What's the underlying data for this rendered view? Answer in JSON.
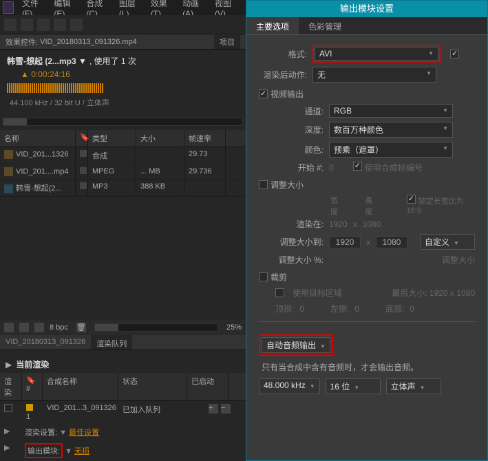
{
  "menu": {
    "file": "文件(F)",
    "edit": "编辑(E)",
    "comp": "合成(C)",
    "layer": "图层(L)",
    "effect": "效果(T)",
    "anim": "动画(A)",
    "view": "视图(V)"
  },
  "fx_header": {
    "label": "效果控件:",
    "file": "VID_20180313_091326.mp4",
    "proj": "项目"
  },
  "info": {
    "title_a": "韩雪-想起 (2...mp3 ▼",
    "title_b": ", 使用了 1 次",
    "time": "▲ 0:00:24:16",
    "audio_meta": "44.100 kHz / 32 bit U / 立体声"
  },
  "cols": {
    "name": "名称",
    "type": "类型",
    "size": "大小",
    "fps": "帧速率"
  },
  "files": [
    {
      "name": "VID_201...1326",
      "type": "合成",
      "size": "",
      "fps": "29.73"
    },
    {
      "name": "VID_201....mp4",
      "type": "MPEG",
      "size": "... MB",
      "fps": "29.736"
    },
    {
      "name": "韩雪-想起(2...",
      "type": "MP3",
      "size": "388 KB",
      "fps": ""
    }
  ],
  "status": {
    "bpc": "8 bpc",
    "pct": "25%"
  },
  "render": {
    "tab1": "VID_20180313_091326",
    "tab2": "渲染队列",
    "current": "当前渲染",
    "hdr": {
      "r": "渲染",
      "n": "#",
      "comp": "合成名称",
      "status": "状态",
      "started": "已启动"
    },
    "row": {
      "num": "1",
      "comp": "VID_201...3_091326",
      "status": "已加入队列"
    },
    "line1_label": "渲染设置:",
    "line1_val": "最佳设置",
    "line2_label": "输出模块:",
    "line2_val": "无损"
  },
  "out": {
    "title": "输出模块设置",
    "tabs": {
      "main": "主要选项",
      "color": "色彩管理"
    },
    "format": "格式:",
    "format_val": "AVI",
    "postaction": "渲染后动作:",
    "postaction_val": "无",
    "video_out": "视频输出",
    "channel": "通道:",
    "channel_val": "RGB",
    "depth": "深度:",
    "depth_val": "数百万种颜色",
    "color": "颜色:",
    "color_val": "预乘（遮罩）",
    "startnum": "开始 #:",
    "startnum_val": "0",
    "use_comp_num": "使用合成帧编号",
    "resize": "调整大小",
    "w": "宽度",
    "h": "高度",
    "lock": "锁定长宽比为  16:9",
    "render_at": "渲染在:",
    "rx": "1920",
    "ry": "1080",
    "resize_to": "调整大小到:",
    "sx": "1920",
    "sy": "1080",
    "custom": "自定义",
    "resize_pct": "调整大小 %:",
    "quality": "调整大小",
    "crop": "裁剪",
    "use_target": "使用目标区域",
    "finalsize": "最后大小: 1920 x 1080",
    "top": "顶部:",
    "top_v": "0",
    "left": "左侧:",
    "left_v": "0",
    "bottom": "底部:",
    "bottom_v": "0",
    "auto_audio": "自动音频输出",
    "audio_hint": "只有当合成中含有音频时，才会输出音频。",
    "khz": "48.000 kHz",
    "bit": "16 位",
    "stereo": "立体声"
  }
}
